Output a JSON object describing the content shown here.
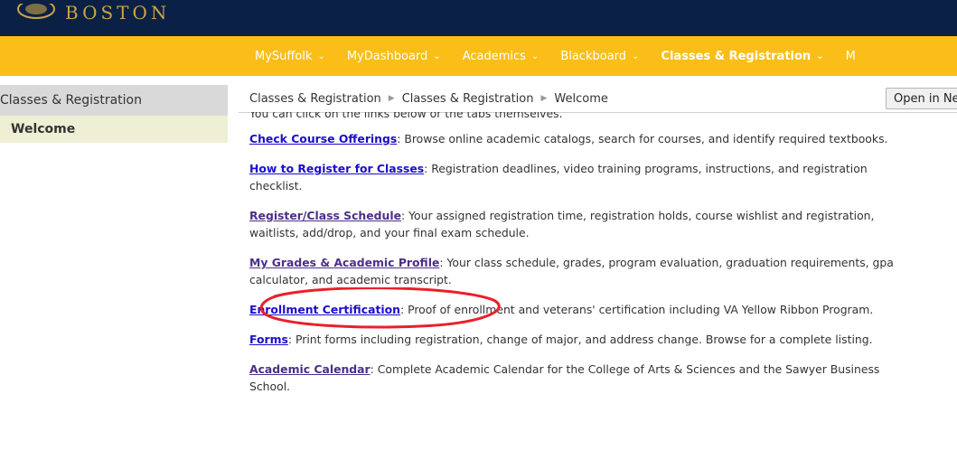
{
  "header": {
    "logo_text": "BOSTON",
    "colors": {
      "header_bg": "#0b2045",
      "nav_bg": "#fbbe18",
      "logo_gold": "#c9a544"
    }
  },
  "nav": {
    "items": [
      {
        "label": "MySuffolk",
        "icon": "chevron-down-icon"
      },
      {
        "label": "MyDashboard",
        "icon": "chevron-down-icon"
      },
      {
        "label": "Academics",
        "icon": "chevron-down-icon"
      },
      {
        "label": "Blackboard",
        "icon": "chevron-down-icon"
      },
      {
        "label": "Classes & Registration",
        "icon": "chevron-down-icon",
        "active": true
      },
      {
        "label": "M"
      }
    ]
  },
  "sidebar": {
    "title": "Classes & Registration",
    "items": [
      {
        "label": "Welcome",
        "selected": true
      }
    ]
  },
  "breadcrumb": {
    "items": [
      "Classes & Registration",
      "Classes & Registration",
      "Welcome"
    ],
    "separator_icon": "triangle-right-icon"
  },
  "toolbar": {
    "open_label": "Open in Ne"
  },
  "content": {
    "intro": "You can click on the links below or the tabs themselves.",
    "entries": [
      {
        "link": "Check Course Offerings",
        "text": ": Browse online academic catalogs, search for courses, and identify required textbooks.",
        "visited": false
      },
      {
        "link": "How to Register for Classes",
        "text": ": Registration deadlines, video training programs, instructions, and registration checklist.",
        "visited": false
      },
      {
        "link": "Register/Class Schedule",
        "text": ": Your assigned registration time, registration holds, course wishlist and registration, waitlists, add/drop, and your final exam schedule.",
        "visited": true
      },
      {
        "link": "My Grades & Academic Profile",
        "text": ": Your class schedule, grades, program evaluation, graduation requirements, gpa calculator, and academic transcript.",
        "visited": true
      },
      {
        "link": "Enrollment Certification",
        "text": ": Proof of enrollment and veterans' certification including VA Yellow Ribbon Program.",
        "visited": false
      },
      {
        "link": "Forms",
        "text": ": Print forms including registration, change of major, and address change. Browse for a complete listing.",
        "visited": false
      },
      {
        "link": "Academic Calendar",
        "text": ": Complete Academic Calendar for the College of Arts & Sciences and the Sawyer Business School.",
        "visited": true
      }
    ]
  },
  "annotation": {
    "color": "#e8202a"
  }
}
